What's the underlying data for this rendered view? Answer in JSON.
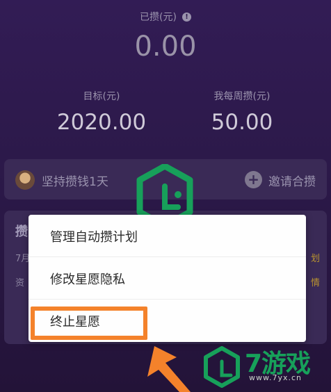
{
  "summary": {
    "saved_label": "已攒(元)",
    "saved_amount": "0.00",
    "target_label": "目标(元)",
    "target_amount": "2020.00",
    "weekly_label": "我每周攒(元)",
    "weekly_amount": "50.00"
  },
  "streak": {
    "text": "坚持攒钱1天",
    "invite_label": "邀请合攒"
  },
  "card": {
    "title": "攒",
    "line1": "7月",
    "line2": "资",
    "right1": "划",
    "right2": "情"
  },
  "menu": {
    "items": [
      {
        "label": "管理自动攒计划"
      },
      {
        "label": "修改星愿隐私"
      },
      {
        "label": "终止星愿"
      }
    ]
  },
  "watermark": {
    "brand": "7游戏",
    "url": "www.7yx.cn"
  },
  "colors": {
    "background": "#2c1a4a",
    "highlight": "#f4822b",
    "watermark_green": "#17a05a"
  }
}
